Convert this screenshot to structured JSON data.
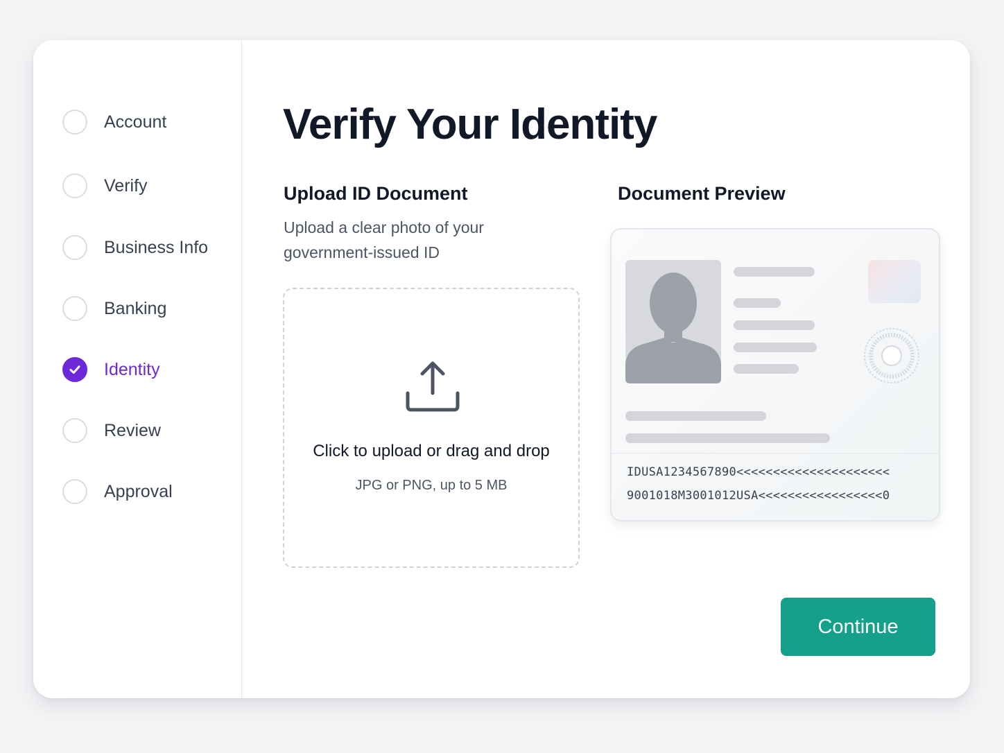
{
  "steps": [
    {
      "label": "Account",
      "state": "pending"
    },
    {
      "label": "Verify",
      "state": "pending"
    },
    {
      "label": "Business Info",
      "state": "pending"
    },
    {
      "label": "Banking",
      "state": "pending"
    },
    {
      "label": "Identity",
      "state": "active",
      "icon": "check-icon"
    },
    {
      "label": "Review",
      "state": "pending"
    },
    {
      "label": "Approval",
      "state": "pending"
    }
  ],
  "page": {
    "title": "Verify Your Identity"
  },
  "upload": {
    "heading": "Upload ID Document",
    "description": "Upload a clear photo of your government-issued ID",
    "icon": "upload-icon",
    "drop_main": "Click to upload or drag and drop",
    "drop_sub": "JPG or PNG, up to 5 MB"
  },
  "preview": {
    "heading": "Document Preview",
    "photo_icon": "person-silhouette-icon",
    "mrz_line1": "IDUSA1234567890<<<<<<<<<<<<<<<<<<<<<",
    "mrz_line2": "9001018M3001012USA<<<<<<<<<<<<<<<<<0"
  },
  "actions": {
    "continue_label": "Continue"
  },
  "colors": {
    "accent": "#6d28d9",
    "primary_button": "#14a08a",
    "text_primary": "#111827",
    "text_secondary": "#4b5563"
  }
}
